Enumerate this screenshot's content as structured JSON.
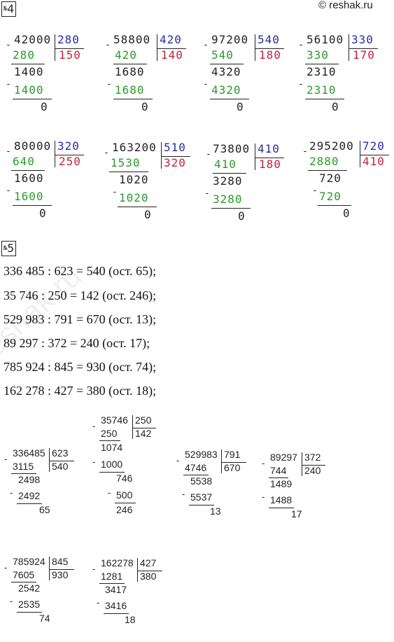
{
  "brand": "© reshak.ru",
  "sections": [
    {
      "number_sign": "№",
      "number": "4"
    },
    {
      "number_sign": "№",
      "number": "5"
    }
  ],
  "task4": [
    {
      "dividend": "42000",
      "divisor": "280",
      "quotient": "150",
      "sub1": "280",
      "rem1": "1400",
      "sub2": "1400",
      "final": "0"
    },
    {
      "dividend": "58800",
      "divisor": "420",
      "quotient": "140",
      "sub1": "420",
      "rem1": "1680",
      "sub2": "1680",
      "final": "0"
    },
    {
      "dividend": "97200",
      "divisor": "540",
      "quotient": "180",
      "sub1": "540",
      "rem1": "4320",
      "sub2": "4320",
      "final": "0"
    },
    {
      "dividend": "56100",
      "divisor": "330",
      "quotient": "170",
      "sub1": "330",
      "rem1": "2310",
      "sub2": "2310",
      "final": "0"
    },
    {
      "dividend": "80000",
      "divisor": "320",
      "quotient": "250",
      "sub1": "640",
      "rem1": "1600",
      "sub2": "1600",
      "final": "0"
    },
    {
      "dividend": "163200",
      "divisor": "510",
      "quotient": "320",
      "sub1": "1530",
      "rem1": "1020",
      "sub2": "1020",
      "final": "0"
    },
    {
      "dividend": "73800",
      "divisor": "410",
      "quotient": "180",
      "sub1": "410",
      "rem1": "3280",
      "sub2": "3280",
      "final": "0"
    },
    {
      "dividend": "295200",
      "divisor": "720",
      "quotient": "410",
      "sub1": "2880",
      "rem1": "720",
      "sub2": "720",
      "final": "0"
    }
  ],
  "task5_equations": [
    "336 485 : 623 = 540 (ост. 65);",
    "35 746 : 250 = 142 (ост. 246);",
    "529 983 : 791 = 670 (ост. 13);",
    "89 297 : 372 = 240 (ост. 17);",
    "785 924 : 845 = 930 (ост. 74);",
    "162 278 : 427 = 380 (ост. 18);"
  ],
  "task5": [
    {
      "dividend": "336485",
      "divisor": "623",
      "quotient": "540",
      "sub1": "3115",
      "rem1": "2498",
      "sub2": "2492",
      "final": "65"
    },
    {
      "dividend": "35746",
      "divisor": "250",
      "quotient": "142",
      "sub1": "250",
      "rem1": "1074",
      "sub2": "1000",
      "rem2": "746",
      "sub3": "500",
      "final": "246"
    },
    {
      "dividend": "529983",
      "divisor": "791",
      "quotient": "670",
      "sub1": "4746",
      "rem1": "5538",
      "sub2": "5537",
      "final": "13"
    },
    {
      "dividend": "89297",
      "divisor": "372",
      "quotient": "240",
      "sub1": "744",
      "rem1": "1489",
      "sub2": "1488",
      "final": "17"
    },
    {
      "dividend": "785924",
      "divisor": "845",
      "quotient": "930",
      "sub1": "7605",
      "rem1": "2542",
      "sub2": "2535",
      "final": "74"
    },
    {
      "dividend": "162278",
      "divisor": "427",
      "quotient": "380",
      "sub1": "1281",
      "rem1": "3417",
      "sub2": "3416",
      "final": "18"
    }
  ],
  "watermark": "reshak.ru"
}
